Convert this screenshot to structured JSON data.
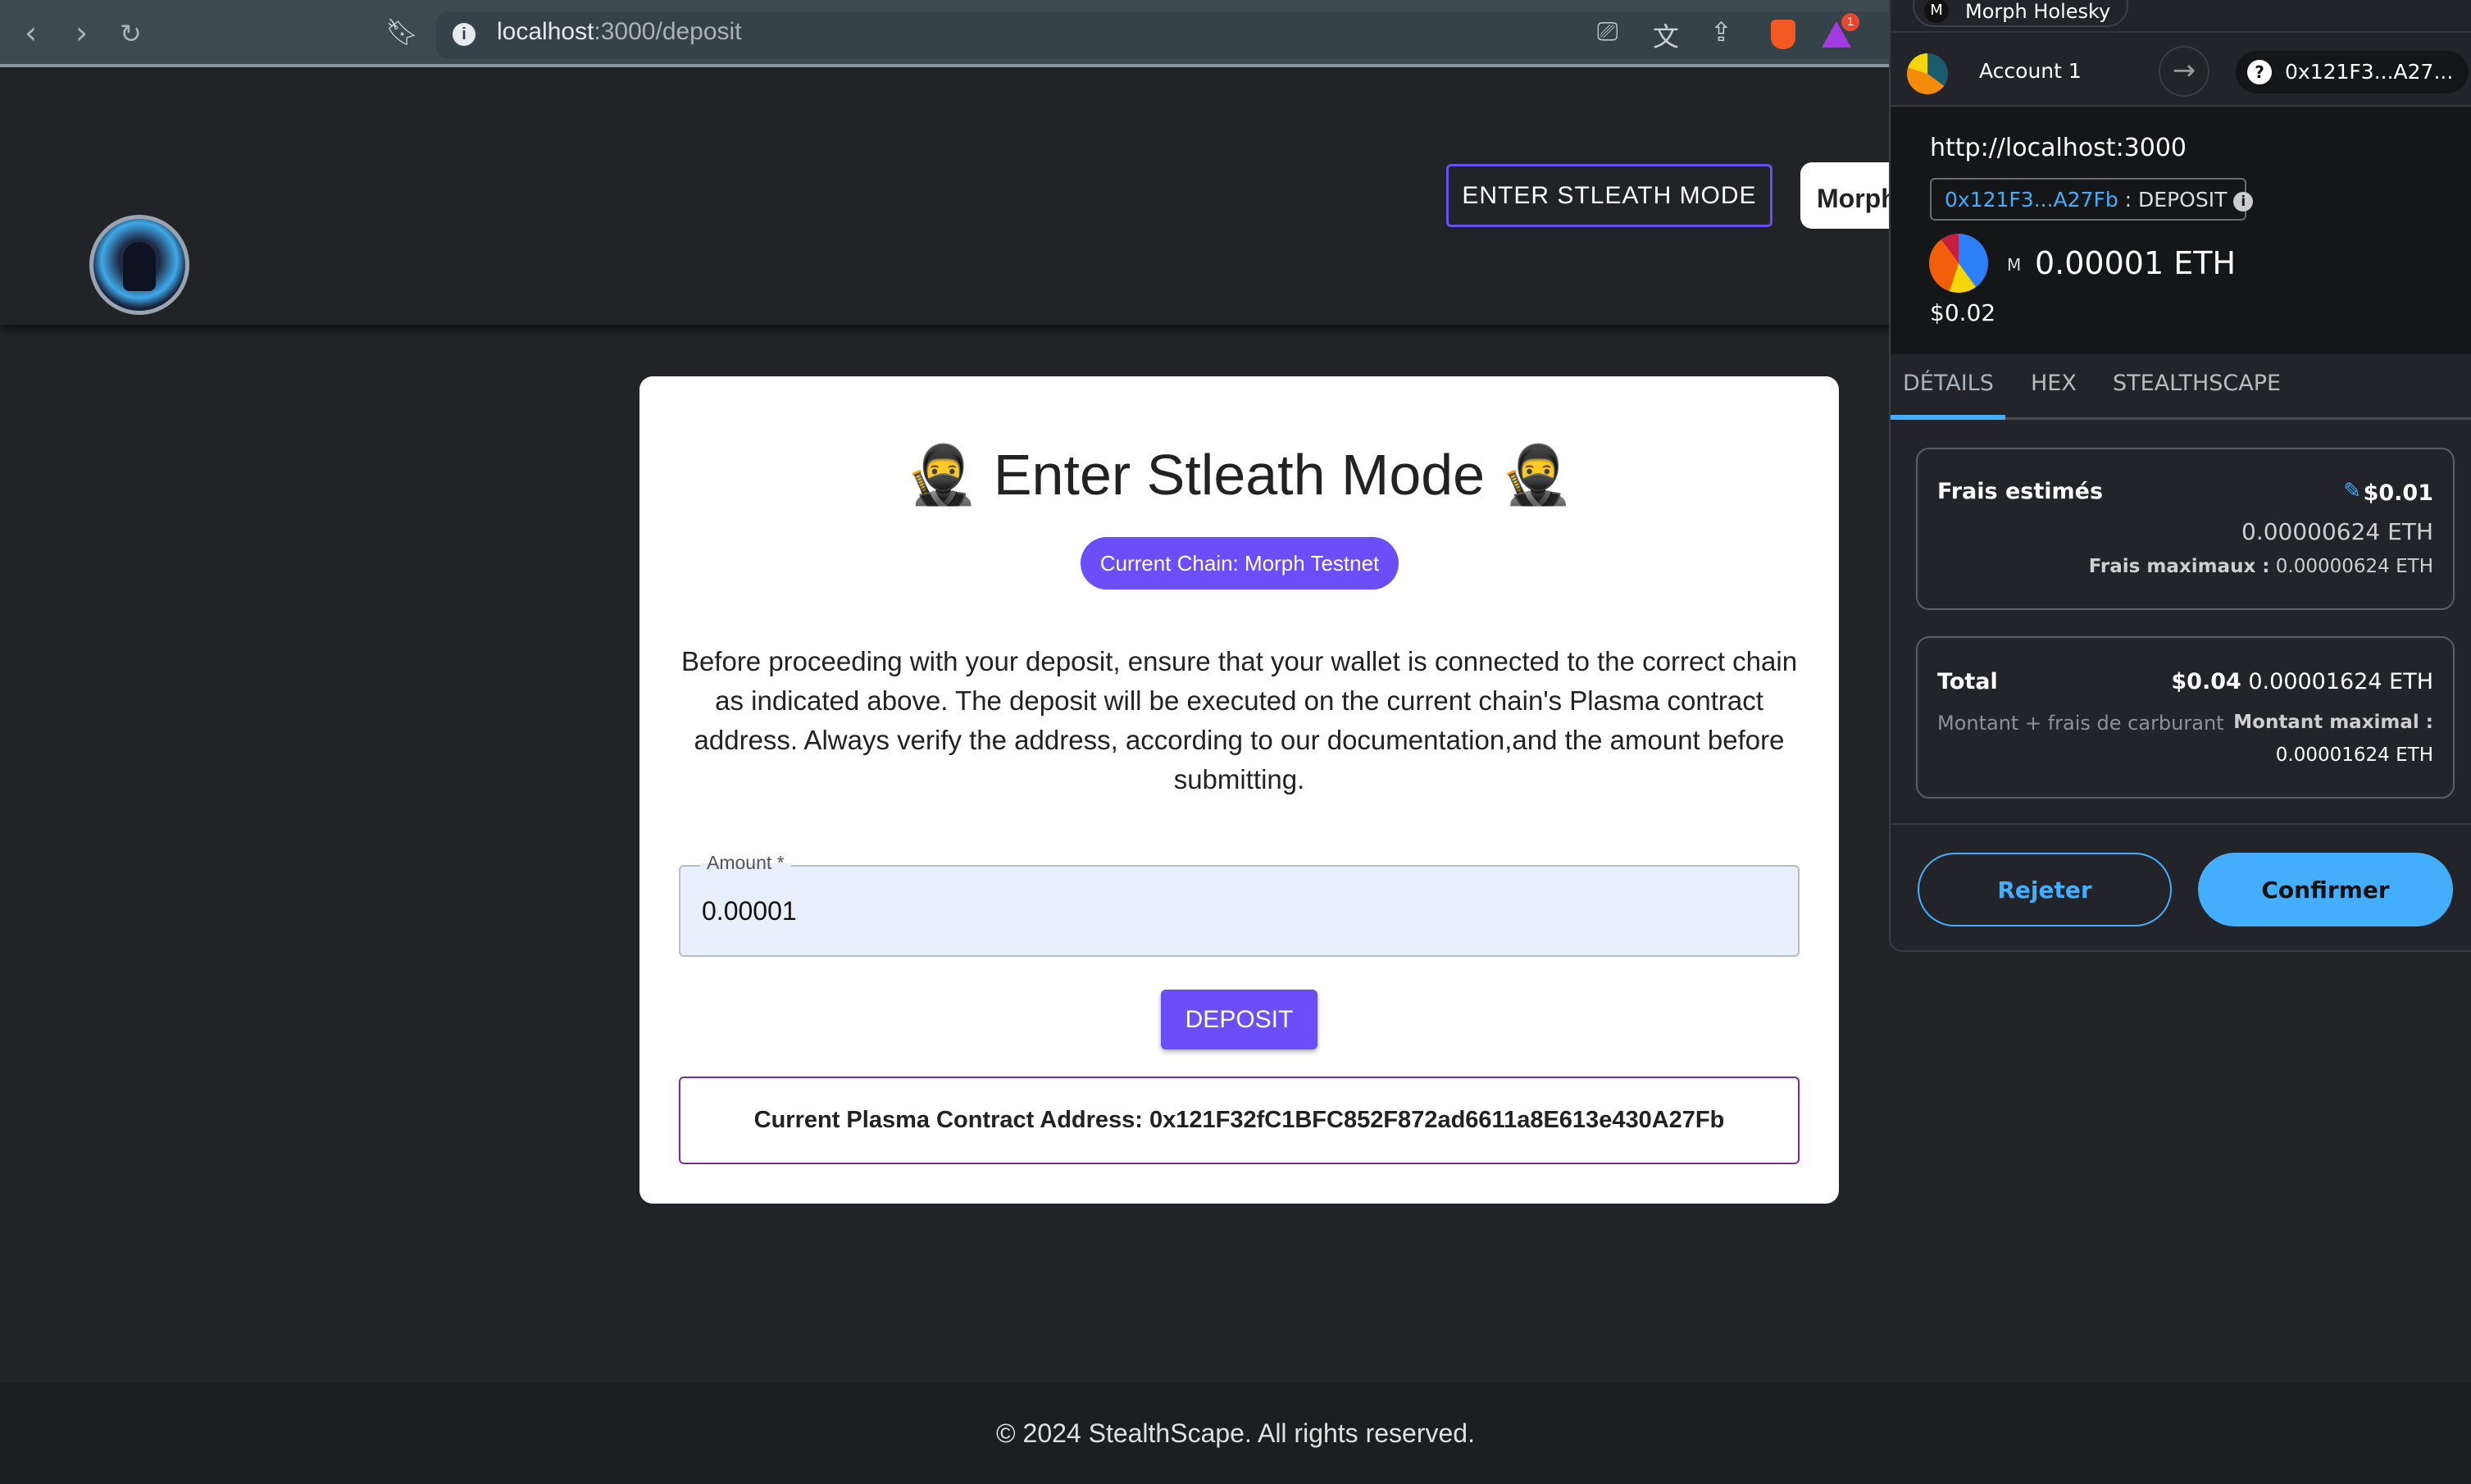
{
  "browser": {
    "url_host": "localhost",
    "url_path": ":3000/deposit",
    "notification_count": "1"
  },
  "header": {
    "stealth_button": "ENTER STLEATH MODE",
    "network_button": "Morph"
  },
  "card": {
    "title": "🥷 Enter Stleath Mode 🥷",
    "chain_chip": "Current Chain: Morph Testnet",
    "description": "Before proceeding with your deposit, ensure that your wallet is connected to the correct chain as indicated above. The deposit will be executed on the current chain's Plasma contract address. Always verify the address, according to our documentation,and the amount before submitting.",
    "amount_label": "Amount *",
    "amount_value": "0.00001",
    "deposit_button": "DEPOSIT",
    "contract_address": "Current Plasma Contract Address: 0x121F32fC1BFC852F872ad6611a8E613e430A27Fb"
  },
  "footer": {
    "text": "© 2024 StealthScape. All rights reserved."
  },
  "wallet": {
    "network": "Morph Holesky",
    "network_letter": "M",
    "account": "Account 1",
    "to_address": "0x121F3...A27...",
    "origin": "http://localhost:3000",
    "contract_short": "0x121F3...A27Fb",
    "method": ": DEPOSIT",
    "amount_letter": "M",
    "amount": "0.00001 ETH",
    "amount_usd": "$0.02",
    "tabs": [
      {
        "label": "DÉTAILS",
        "active": true
      },
      {
        "label": "HEX"
      },
      {
        "label": "STEALTHSCAPE"
      }
    ],
    "fees": {
      "label": "Frais estimés",
      "usd": "$0.01",
      "eth": "0.00000624 ETH",
      "max_label": "Frais maximaux :",
      "max_value": "0.00000624 ETH"
    },
    "total": {
      "label": "Total",
      "usd": "$0.04",
      "eth": "0.00001624 ETH",
      "sublabel": "Montant + frais de carburant",
      "max_label": "Montant maximal :",
      "max_value": "0.00001624 ETH"
    },
    "reject": "Rejeter",
    "confirm": "Confirmer",
    "accent": "#43aefc"
  },
  "colors": {
    "primary": "#6b4ef8",
    "background": "#222327"
  }
}
